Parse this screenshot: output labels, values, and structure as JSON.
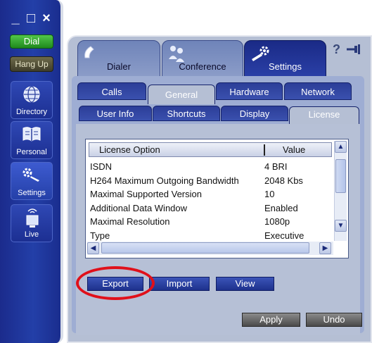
{
  "window_controls": {
    "minimize": "_",
    "maximize": "□",
    "close": "×"
  },
  "sidebar": {
    "dial_label": "Dial",
    "hangup_label": "Hang Up",
    "items": [
      {
        "label": "Directory",
        "icon": "globe-icon"
      },
      {
        "label": "Personal",
        "icon": "book-icon"
      },
      {
        "label": "Settings",
        "icon": "settings-wrench-icon"
      },
      {
        "label": "Live",
        "icon": "live-monitor-icon"
      }
    ]
  },
  "top_tabs": [
    {
      "label": "Dialer",
      "icon": "handset-icon"
    },
    {
      "label": "Conference",
      "icon": "conference-icon"
    },
    {
      "label": "Settings",
      "icon": "settings-wrench-icon",
      "selected": true
    }
  ],
  "header_icons": {
    "help": "?",
    "pin": "pin-icon"
  },
  "settings_tabs": [
    "Calls",
    "General",
    "Hardware",
    "Network"
  ],
  "general_tabs": [
    "User Info",
    "Shortcuts",
    "Display",
    "License"
  ],
  "license_table": {
    "columns": [
      "License Option",
      "Value"
    ],
    "rows": [
      [
        "ISDN",
        "4 BRI"
      ],
      [
        "H264 Maximum Outgoing Bandwidth",
        "2048 Kbs"
      ],
      [
        "Maximal Supported Version",
        "10"
      ],
      [
        "Additional Data Window",
        "Enabled"
      ],
      [
        "Maximal Resolution",
        "1080p"
      ],
      [
        "Type",
        "Executive"
      ]
    ]
  },
  "buttons": {
    "export": "Export",
    "import": "Import",
    "view": "View",
    "apply": "Apply",
    "undo": "Undo"
  },
  "colors": {
    "sidebar": "#233fa8",
    "panel": "#b5bfd4",
    "highlight": "#e0101a",
    "dial_green": "#2fa82a"
  }
}
